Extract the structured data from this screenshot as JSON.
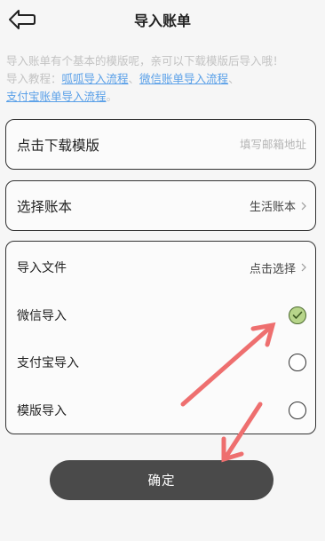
{
  "header": {
    "title": "导入账单",
    "back_icon": "back-arrow-icon"
  },
  "intro": {
    "text1": "导入账单有个基本的模版呢，亲可以下载模版后导入哦！",
    "text2_prefix": "导入教程：",
    "link1": "呱呱导入流程",
    "sep1": "、",
    "link2": "微信账单导入流程",
    "sep2": "、",
    "link3": "支付宝账单导入流程",
    "end": "。"
  },
  "download": {
    "label": "点击下载模版",
    "email_placeholder": "填写邮箱地址",
    "email_value": ""
  },
  "ledger": {
    "label": "选择账本",
    "value": "生活账本",
    "chevron_icon": "chevron-right-icon"
  },
  "import": {
    "file_label": "导入文件",
    "file_value": "点击选择",
    "options": [
      {
        "label": "微信导入",
        "checked": true
      },
      {
        "label": "支付宝导入",
        "checked": false
      },
      {
        "label": "模版导入",
        "checked": false
      }
    ]
  },
  "confirm_label": "确定",
  "colors": {
    "background": "#f6f6f6",
    "link": "#5aa0e8",
    "hint_text": "#c3c3c3",
    "button_bg": "#4a4a4a",
    "radio_checked": "#b7d58a",
    "annotation_arrow": "#ee6f6f"
  }
}
